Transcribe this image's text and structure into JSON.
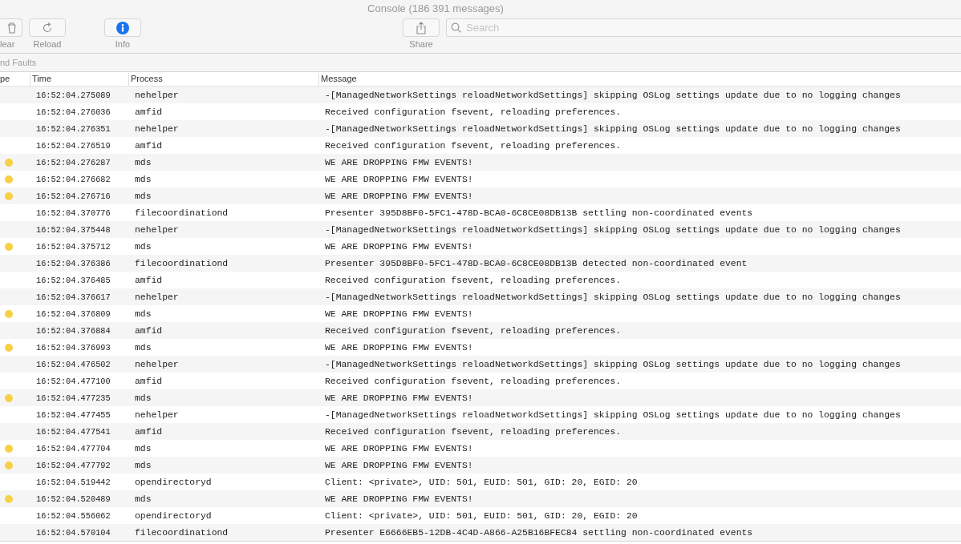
{
  "window": {
    "title": "Console (186 391 messages)"
  },
  "toolbar": {
    "buttons": [
      {
        "label": "lear",
        "kind": "clear"
      },
      {
        "label": "Reload",
        "kind": "reload"
      },
      {
        "label": "Info",
        "kind": "info"
      },
      {
        "label": "Share",
        "kind": "share"
      }
    ],
    "search": {
      "placeholder": "Search"
    }
  },
  "filter_bar": {
    "label": "nd Faults"
  },
  "table": {
    "columns": [
      "pe",
      "Time",
      "Process",
      "Message"
    ],
    "rows": [
      {
        "kind": "default",
        "time": "16:52:04.275089",
        "process": "nehelper",
        "message": "-[ManagedNetworkSettings reloadNetworkdSettings] skipping OSLog settings update due to no logging changes"
      },
      {
        "kind": "default",
        "time": "16:52:04.276036",
        "process": "amfid",
        "message": "Received configuration fsevent, reloading preferences."
      },
      {
        "kind": "default",
        "time": "16:52:04.276351",
        "process": "nehelper",
        "message": "-[ManagedNetworkSettings reloadNetworkdSettings] skipping OSLog settings update due to no logging changes"
      },
      {
        "kind": "default",
        "time": "16:52:04.276519",
        "process": "amfid",
        "message": "Received configuration fsevent, reloading preferences."
      },
      {
        "kind": "error",
        "time": "16:52:04.276287",
        "process": "mds",
        "message": "WE ARE DROPPING FMW EVENTS!"
      },
      {
        "kind": "error",
        "time": "16:52:04.276682",
        "process": "mds",
        "message": "WE ARE DROPPING FMW EVENTS!"
      },
      {
        "kind": "error",
        "time": "16:52:04.276716",
        "process": "mds",
        "message": "WE ARE DROPPING FMW EVENTS!"
      },
      {
        "kind": "default",
        "time": "16:52:04.370776",
        "process": "filecoordinationd",
        "message": "Presenter 395D8BF0-5FC1-478D-BCA0-6C8CE08DB13B settling non-coordinated events"
      },
      {
        "kind": "default",
        "time": "16:52:04.375448",
        "process": "nehelper",
        "message": "-[ManagedNetworkSettings reloadNetworkdSettings] skipping OSLog settings update due to no logging changes"
      },
      {
        "kind": "error",
        "time": "16:52:04.375712",
        "process": "mds",
        "message": "WE ARE DROPPING FMW EVENTS!"
      },
      {
        "kind": "default",
        "time": "16:52:04.376386",
        "process": "filecoordinationd",
        "message": "Presenter 395D8BF0-5FC1-478D-BCA0-6C8CE08DB13B detected non-coordinated event"
      },
      {
        "kind": "default",
        "time": "16:52:04.376485",
        "process": "amfid",
        "message": "Received configuration fsevent, reloading preferences."
      },
      {
        "kind": "default",
        "time": "16:52:04.376617",
        "process": "nehelper",
        "message": "-[ManagedNetworkSettings reloadNetworkdSettings] skipping OSLog settings update due to no logging changes"
      },
      {
        "kind": "error",
        "time": "16:52:04.376809",
        "process": "mds",
        "message": "WE ARE DROPPING FMW EVENTS!"
      },
      {
        "kind": "default",
        "time": "16:52:04.376884",
        "process": "amfid",
        "message": "Received configuration fsevent, reloading preferences."
      },
      {
        "kind": "error",
        "time": "16:52:04.376993",
        "process": "mds",
        "message": "WE ARE DROPPING FMW EVENTS!"
      },
      {
        "kind": "default",
        "time": "16:52:04.476502",
        "process": "nehelper",
        "message": "-[ManagedNetworkSettings reloadNetworkdSettings] skipping OSLog settings update due to no logging changes"
      },
      {
        "kind": "default",
        "time": "16:52:04.477100",
        "process": "amfid",
        "message": "Received configuration fsevent, reloading preferences."
      },
      {
        "kind": "error",
        "time": "16:52:04.477235",
        "process": "mds",
        "message": "WE ARE DROPPING FMW EVENTS!"
      },
      {
        "kind": "default",
        "time": "16:52:04.477455",
        "process": "nehelper",
        "message": "-[ManagedNetworkSettings reloadNetworkdSettings] skipping OSLog settings update due to no logging changes"
      },
      {
        "kind": "default",
        "time": "16:52:04.477541",
        "process": "amfid",
        "message": "Received configuration fsevent, reloading preferences."
      },
      {
        "kind": "error",
        "time": "16:52:04.477704",
        "process": "mds",
        "message": "WE ARE DROPPING FMW EVENTS!"
      },
      {
        "kind": "error",
        "time": "16:52:04.477792",
        "process": "mds",
        "message": "WE ARE DROPPING FMW EVENTS!"
      },
      {
        "kind": "default",
        "time": "16:52:04.519442",
        "process": "opendirectoryd",
        "message": "Client: <private>, UID: 501, EUID: 501, GID: 20, EGID: 20"
      },
      {
        "kind": "error",
        "time": "16:52:04.520489",
        "process": "mds",
        "message": "WE ARE DROPPING FMW EVENTS!"
      },
      {
        "kind": "default",
        "time": "16:52:04.556062",
        "process": "opendirectoryd",
        "message": "Client: <private>, UID: 501, EUID: 501, GID: 20, EGID: 20"
      },
      {
        "kind": "default",
        "time": "16:52:04.570104",
        "process": "filecoordinationd",
        "message": "Presenter E6666EB5-12DB-4C4D-A866-A25B16BFEC84 settling non-coordinated events"
      }
    ]
  }
}
